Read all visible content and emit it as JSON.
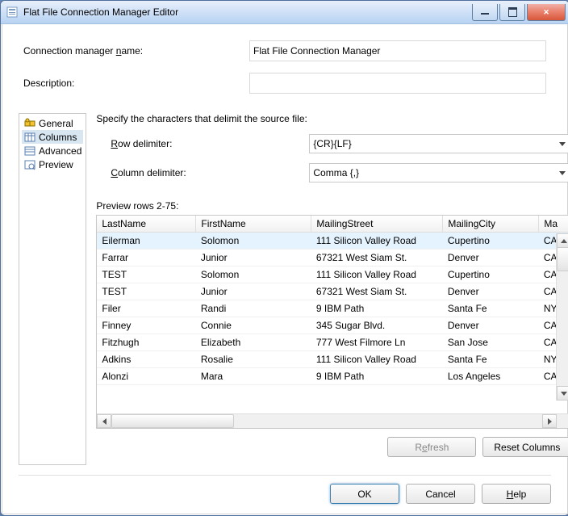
{
  "title": "Flat File Connection Manager Editor",
  "form": {
    "nameLabel": "Connection manager name:",
    "nameValue": "Flat File Connection Manager",
    "descLabel": "Description:",
    "descValue": ""
  },
  "nav": {
    "items": [
      {
        "label": "General"
      },
      {
        "label": "Columns"
      },
      {
        "label": "Advanced"
      },
      {
        "label": "Preview"
      }
    ],
    "selectedIndex": 1
  },
  "section": {
    "title": "Specify the characters that delimit the source file:",
    "rowDelimLabel": "Row delimiter:",
    "rowDelimValue": "{CR}{LF}",
    "colDelimLabel": "Column delimiter:",
    "colDelimValue": "Comma {,}",
    "previewLabel": "Preview rows 2-75:"
  },
  "grid": {
    "columns": [
      "LastName",
      "FirstName",
      "MailingStreet",
      "MailingCity",
      "Ma"
    ],
    "rows": [
      [
        "Eilerman",
        "Solomon",
        "111 Silicon Valley Road",
        "Cupertino",
        "CA"
      ],
      [
        "Farrar",
        "Junior",
        "67321 West Siam St.",
        "Denver",
        "CA"
      ],
      [
        "TEST",
        "Solomon",
        "111 Silicon Valley Road",
        "Cupertino",
        "CA"
      ],
      [
        "TEST",
        "Junior",
        "67321 West Siam St.",
        "Denver",
        "CA"
      ],
      [
        "Filer",
        "Randi",
        "9 IBM Path",
        "Santa Fe",
        "NY"
      ],
      [
        "Finney",
        "Connie",
        "345 Sugar Blvd.",
        "Denver",
        "CA"
      ],
      [
        "Fitzhugh",
        "Elizabeth",
        "777 West Filmore Ln",
        "San Jose",
        "CA"
      ],
      [
        "Adkins",
        "Rosalie",
        "111 Silicon Valley Road",
        "Santa Fe",
        "NY"
      ],
      [
        "Alonzi",
        "Mara",
        "9 IBM Path",
        "Los Angeles",
        "CA"
      ]
    ],
    "selectedRow": 0
  },
  "buttons": {
    "refresh": "Refresh",
    "reset": "Reset Columns",
    "ok": "OK",
    "cancel": "Cancel",
    "help": "Help"
  }
}
